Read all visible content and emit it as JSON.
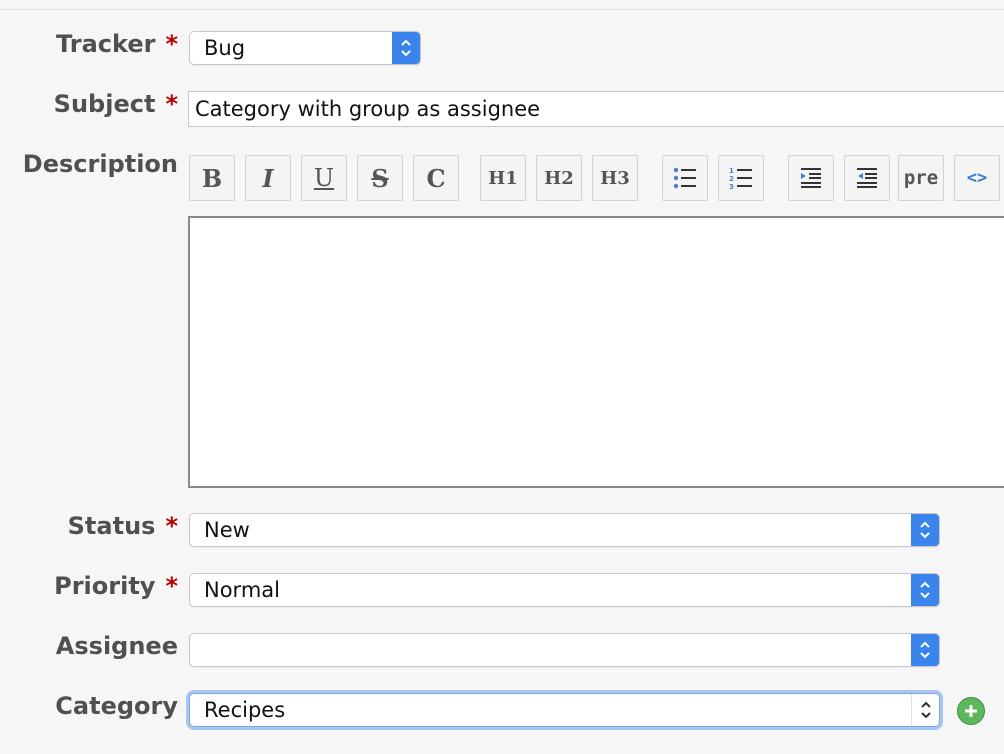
{
  "form": {
    "tracker": {
      "label": "Tracker",
      "required_mark": "*",
      "value": "Bug"
    },
    "subject": {
      "label": "Subject",
      "required_mark": "*",
      "value": "Category with group as assignee"
    },
    "description": {
      "label": "Description",
      "toolbar": [
        {
          "name": "bold-button",
          "text": "B"
        },
        {
          "name": "italic-button",
          "text": "I"
        },
        {
          "name": "underline-button",
          "text": "U"
        },
        {
          "name": "strikethrough-button",
          "text": "S"
        },
        {
          "name": "code-button",
          "text": "C"
        },
        {
          "name": "heading1-button",
          "text": "H1"
        },
        {
          "name": "heading2-button",
          "text": "H2"
        },
        {
          "name": "heading3-button",
          "text": "H3"
        },
        {
          "name": "unordered-list-button",
          "icon": "unordered-list-icon"
        },
        {
          "name": "ordered-list-button",
          "icon": "ordered-list-icon"
        },
        {
          "name": "indent-button",
          "icon": "indent-icon"
        },
        {
          "name": "outdent-button",
          "icon": "outdent-icon"
        },
        {
          "name": "preformatted-button",
          "text": "pre"
        },
        {
          "name": "inline-code-button",
          "text": "<>"
        }
      ],
      "value": ""
    },
    "status": {
      "label": "Status",
      "required_mark": "*",
      "value": "New"
    },
    "priority": {
      "label": "Priority",
      "required_mark": "*",
      "value": "Normal"
    },
    "assignee": {
      "label": "Assignee",
      "value": ""
    },
    "category": {
      "label": "Category",
      "value": "Recipes",
      "add_icon": "plus-circle-icon"
    }
  },
  "colors": {
    "required": "#bb0000",
    "select_arrow_bg": "#3a84ec",
    "focus_ring": "#a7c6f0",
    "add_button": "#5db85c"
  }
}
